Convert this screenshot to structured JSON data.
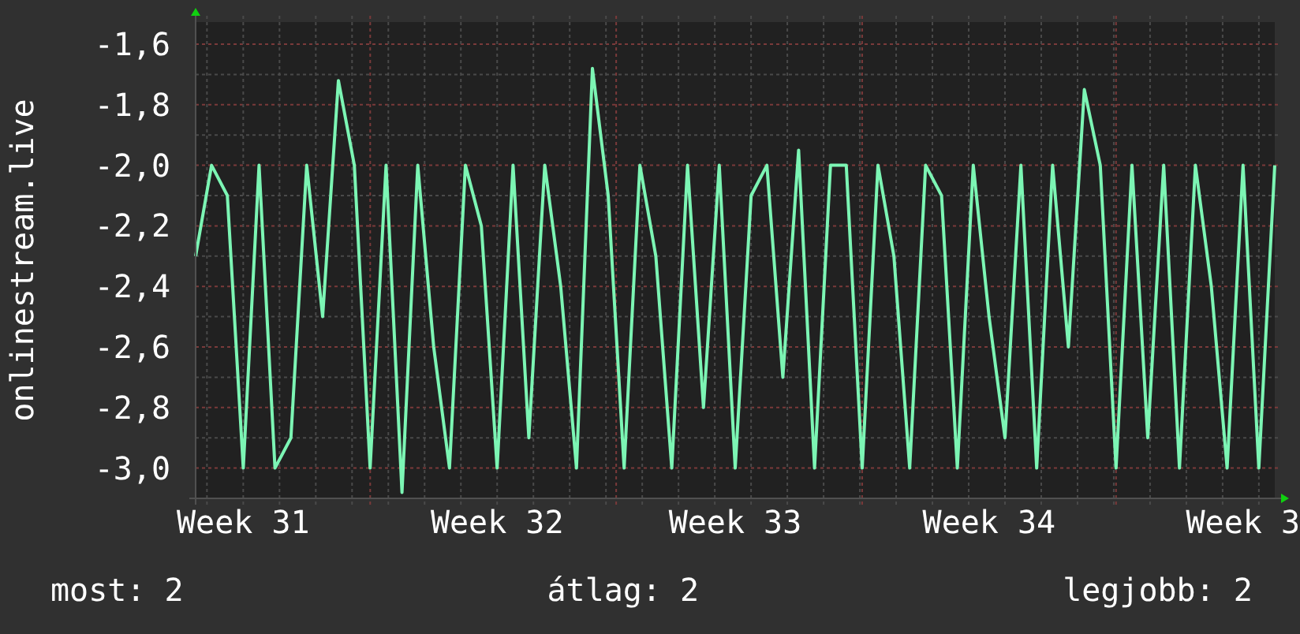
{
  "chart_data": {
    "type": "line",
    "ylabel": "onlinestream.live",
    "grid": true,
    "categories": [
      null,
      null,
      null,
      "Week 31",
      null,
      null,
      null,
      null,
      null,
      null,
      null,
      null,
      null,
      null,
      null,
      null,
      null,
      null,
      null,
      "Week 32",
      null,
      null,
      null,
      null,
      null,
      null,
      null,
      null,
      null,
      null,
      null,
      null,
      null,
      null,
      "Week 33",
      null,
      null,
      null,
      null,
      null,
      null,
      null,
      null,
      null,
      null,
      null,
      null,
      null,
      null,
      null,
      "Week 34",
      null,
      null,
      null,
      null,
      null,
      null,
      null,
      null,
      null,
      null,
      null,
      null,
      null,
      null,
      null,
      "Week 3",
      null,
      null
    ],
    "ylim": [
      -3.1,
      -1.527
    ],
    "yticks": [
      {
        "value": -1.6,
        "label": "-1,6"
      },
      {
        "value": -1.8,
        "label": "-1,8"
      },
      {
        "value": -2.0,
        "label": "-2,0"
      },
      {
        "value": -2.2,
        "label": "-2,2"
      },
      {
        "value": -2.4,
        "label": "-2,4"
      },
      {
        "value": -2.6,
        "label": "-2,6"
      },
      {
        "value": -2.8,
        "label": "-2,8"
      },
      {
        "value": -3.0,
        "label": "-3,0"
      }
    ],
    "series": [
      {
        "color": "#7cf5b4",
        "values": [
          -2.3,
          -2.0,
          -2.1,
          -3.0,
          -2.0,
          -3.0,
          -2.9,
          -2.0,
          -2.5,
          -1.72,
          -2.0,
          -3.0,
          -2.0,
          -3.08,
          -2.0,
          -2.6,
          -3.0,
          -2.0,
          -2.2,
          -3.0,
          -2.0,
          -2.9,
          -2.0,
          -2.4,
          -3.0,
          -1.68,
          -2.1,
          -3.0,
          -2.0,
          -2.3,
          -3.0,
          -2.0,
          -2.8,
          -2.0,
          -3.0,
          -2.1,
          -2.0,
          -2.7,
          -1.95,
          -3.0,
          -2.0,
          -2.0,
          -3.0,
          -2.0,
          -2.3,
          -3.0,
          -2.0,
          -2.1,
          -3.0,
          -2.0,
          -2.5,
          -2.9,
          -2.0,
          -3.0,
          -2.0,
          -2.6,
          -1.75,
          -2.0,
          -3.0,
          -2.0,
          -2.9,
          -2.0,
          -3.0,
          -2.0,
          -2.4,
          -3.0,
          -2.0,
          -3.0,
          -2.0
        ]
      }
    ]
  },
  "legend": [
    "most: 2",
    "átlag: 2",
    "legjobb: 2"
  ]
}
